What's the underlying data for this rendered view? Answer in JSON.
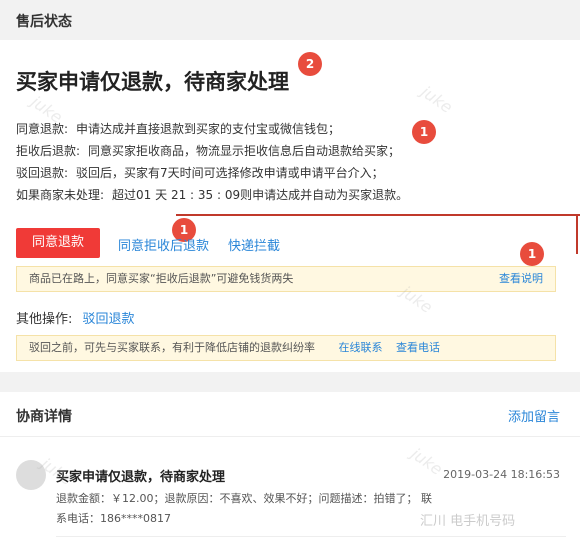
{
  "section_status": {
    "header_title": "售后状态",
    "main_title": "买家申请仅退款，待商家处理",
    "badges": [
      "2",
      "1",
      "1",
      "1"
    ],
    "rows": [
      {
        "label": "同意退款:",
        "text": "申请达成并直接退款到买家的支付宝或微信钱包；"
      },
      {
        "label": "拒收后退款:",
        "text": "同意买家拒收商品，物流显示拒收信息后自动退款给买家；"
      },
      {
        "label": "驳回退款:",
        "text": "驳回后，买家有7天时间可选择修改申请或申请平台介入；"
      },
      {
        "label": "如果商家未处理:",
        "text": "超过01 天 21 : 35 : 09则申请达成并自动为买家退款。"
      }
    ],
    "actions": {
      "agree_button": "同意退款",
      "reject_receipt_link": "同意拒收后退款",
      "quick_intercept_link": "快递拦截"
    },
    "notice1": {
      "text": "商品已在路上，同意买家“拒收后退款”可避免钱货两失",
      "link": "查看说明"
    },
    "other_ops": {
      "label": "其他操作:",
      "link": "驳回退款"
    },
    "notice2": {
      "text": "驳回之前，可先与买家联系，有利于降低店铺的退款纠纷率",
      "link1": "在线联系",
      "link2": "查看电话"
    }
  },
  "section_nego": {
    "title": "协商详情",
    "add_comment": "添加留言",
    "entry": {
      "title": "买家申请仅退款，待商家处理",
      "time": "2019-03-24 18:16:53",
      "line1": "退款金额：￥12.00；退款原因：不喜欢、效果不好；问题描述：拍错了；  联",
      "line2": "系电话：186****0817"
    }
  },
  "watermark": {
    "brand": "juke",
    "logo": "汇川 电手机号码"
  }
}
